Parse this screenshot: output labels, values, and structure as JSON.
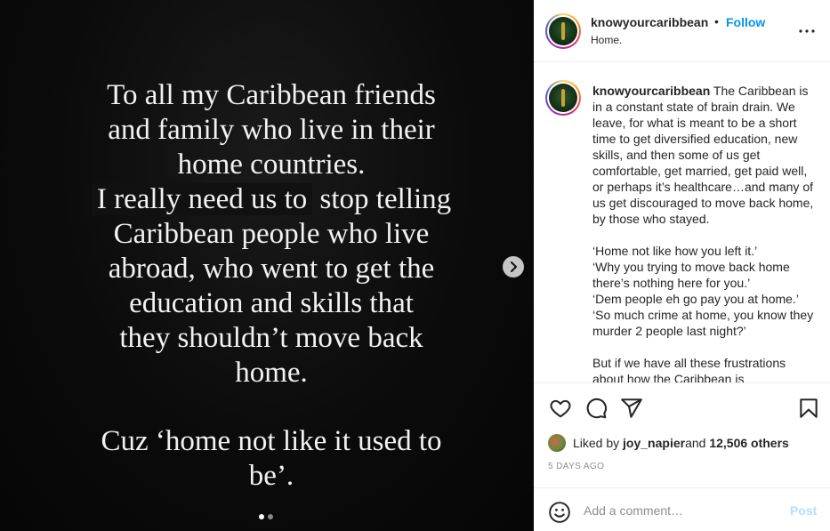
{
  "slide": {
    "lines": [
      "To all my Caribbean friends",
      "and family who live in their",
      "home countries."
    ],
    "highlight": "I really need us to",
    "highlight_rest": " stop telling",
    "lines2": [
      "Caribbean people who live",
      "abroad, who went to get the",
      "education and skills  that",
      "they shouldn’t move back",
      "home."
    ],
    "lines3": [
      "Cuz ‘home not like it used to",
      "be’."
    ],
    "slide_count": 2,
    "active_slide": 1
  },
  "header": {
    "username": "knowyourcaribbean",
    "separator": "•",
    "follow_label": "Follow",
    "subtitle": "Home."
  },
  "caption": {
    "username": "knowyourcaribbean",
    "paragraph1": "The Caribbean is in a constant state of brain drain. We leave, for what is meant to be a short time to get diversified education, new skills, and then some of us get comfortable, get married, get paid well, or perhaps it’s healthcare…and many of us get discouraged to move back home, by those who stayed.",
    "quotes": [
      "‘Home not like how you left it.’",
      "‘Why you trying to move back home there’s nothing here for you.’",
      "‘Dem people eh go pay you at home.’",
      "‘So much crime at home, you know they murder 2 people last night?’"
    ],
    "paragraph3": "But if we have all these frustrations about how the Caribbean is"
  },
  "likes": {
    "prefix": "Liked by ",
    "user": "joy_napier",
    "and": " and ",
    "count": "12,506 others"
  },
  "timestamp": "5 DAYS AGO",
  "comment": {
    "placeholder": "Add a comment…",
    "post_label": "Post"
  },
  "colors": {
    "follow": "#0095f6",
    "post_disabled": "#b2dffc",
    "text": "#262626",
    "muted": "#8e8e8e"
  },
  "icons": [
    "chevron-right-icon",
    "more-icon",
    "heart-icon",
    "comment-icon",
    "share-icon",
    "bookmark-icon",
    "emoji-icon"
  ]
}
